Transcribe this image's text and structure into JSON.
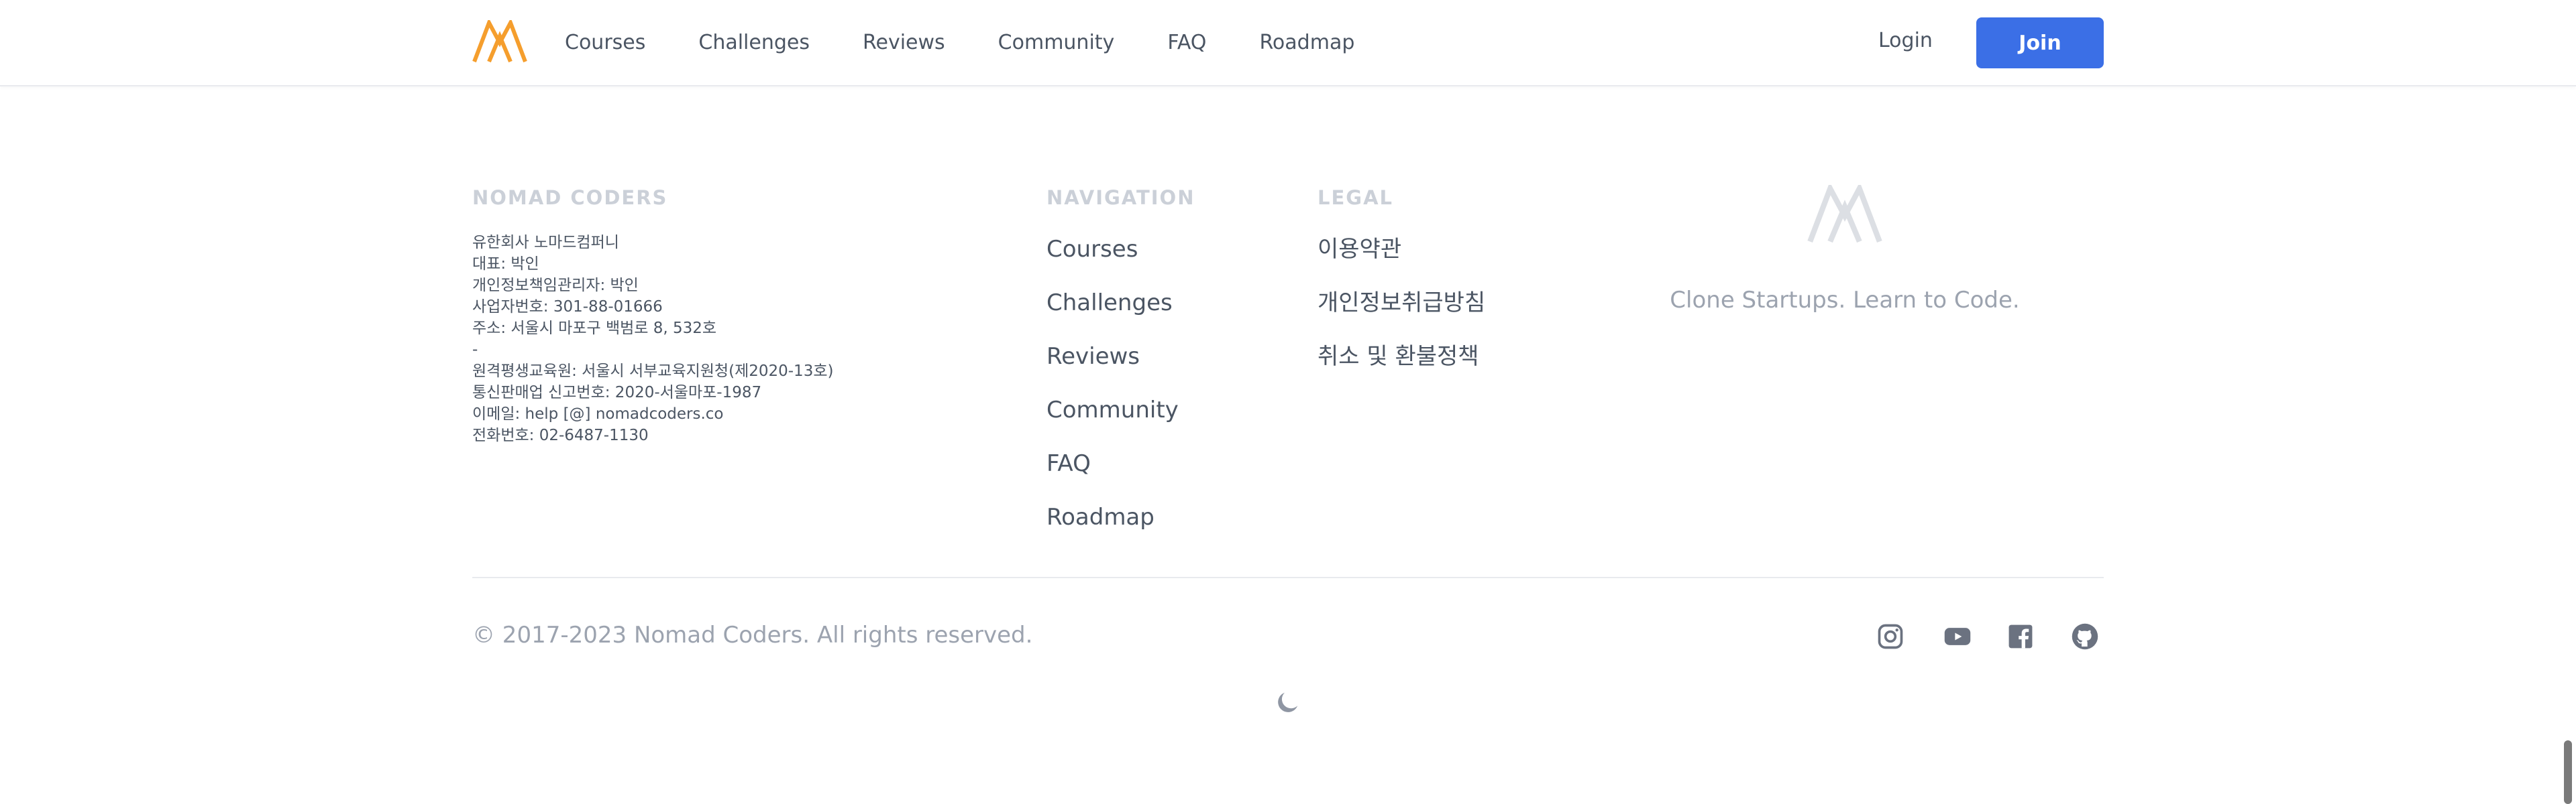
{
  "header": {
    "nav": [
      "Courses",
      "Challenges",
      "Reviews",
      "Community",
      "FAQ",
      "Roadmap"
    ],
    "login_label": "Login",
    "join_label": "Join",
    "logo_icon": "nomad-coders-logo-icon",
    "brand_color": "#f59e2d",
    "accent_color": "#3b6fe6"
  },
  "footer": {
    "company": {
      "title": "NOMAD CODERS",
      "lines": [
        "유한회사 노마드컴퍼니",
        "대표: 박인",
        "개인정보책임관리자: 박인",
        "사업자번호: 301-88-01666",
        "주소: 서울시 마포구 백범로 8, 532호",
        "-",
        "원격평생교육원: 서울시 서부교육지원청(제2020-13호)",
        "통신판매업 신고번호: 2020-서울마포-1987",
        "이메일: help [@] nomadcoders.co",
        "전화번호: 02-6487-1130"
      ]
    },
    "navigation": {
      "title": "NAVIGATION",
      "links": [
        "Courses",
        "Challenges",
        "Reviews",
        "Community",
        "FAQ",
        "Roadmap"
      ]
    },
    "legal": {
      "title": "LEGAL",
      "links": [
        "이용약관",
        "개인정보취급방침",
        "취소 및 환불정책"
      ]
    },
    "tagline": "Clone Startups. Learn to Code.",
    "copyright": "© 2017-2023 Nomad Coders. All rights reserved.",
    "social_icons": [
      "instagram-icon",
      "youtube-icon",
      "facebook-icon",
      "github-icon"
    ],
    "theme_toggle_icon": "moon-icon"
  }
}
